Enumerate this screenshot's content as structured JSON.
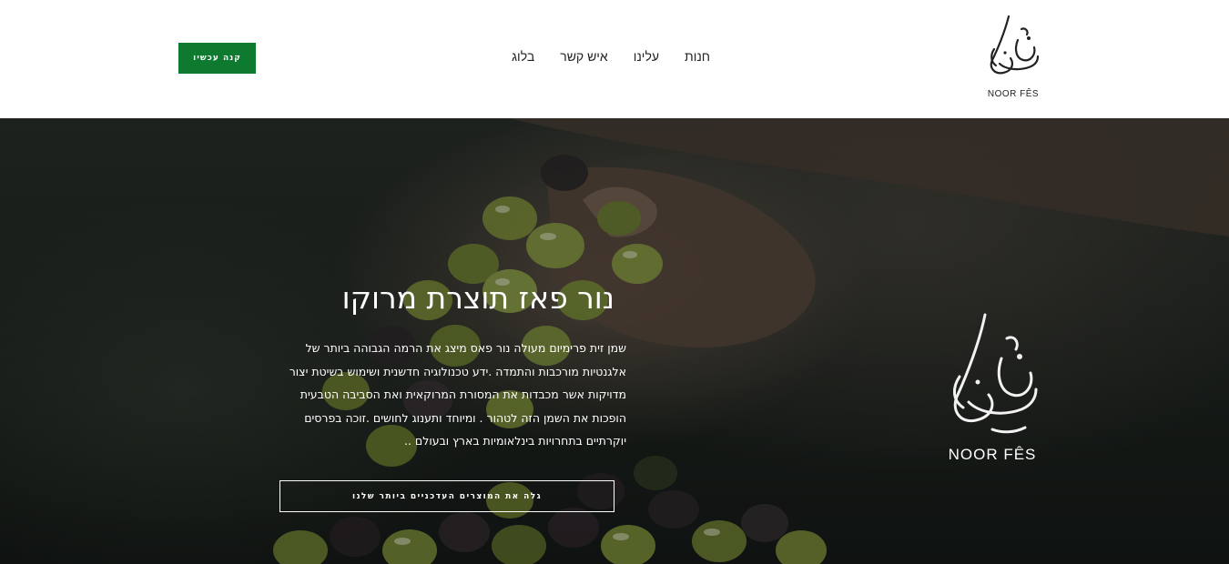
{
  "header": {
    "buy_button": "קנה עכשיו",
    "nav": [
      "חנות",
      "עלינו",
      "איש קשר",
      "בלוג"
    ],
    "logo_text": "NOOR FÊS"
  },
  "hero": {
    "title": "נור פאז תוצרת מרוקו",
    "description": "שמן זית פרימיום מעולה נור פאס מיצג את הרמה הגבוהה ביותר של אלגנטיות מורכבות והתמדה .ידע טכנולוגיה חדשנית ושימוש בשיטת יצור מדויקות אשר מכבדות את המסורת המרוקאית ואת הסביבה הטבעית הופכות את השמן הזה לטהור . ומיוחד ותענוג לחושים .זוכה בפרסים יוקרתיים בתחרויות בינלאומיות בארץ ובעולם ..",
    "cta": "גלה את המוצרים העדכניים ביותר שלנו",
    "logo_name": "NOOR FÊS"
  },
  "colors": {
    "accent": "#0d7a2f",
    "header_bg": "#ffffff",
    "hero_text": "#ffffff"
  },
  "icons": {
    "logo": "noor-fes-calligraphy-logo"
  }
}
